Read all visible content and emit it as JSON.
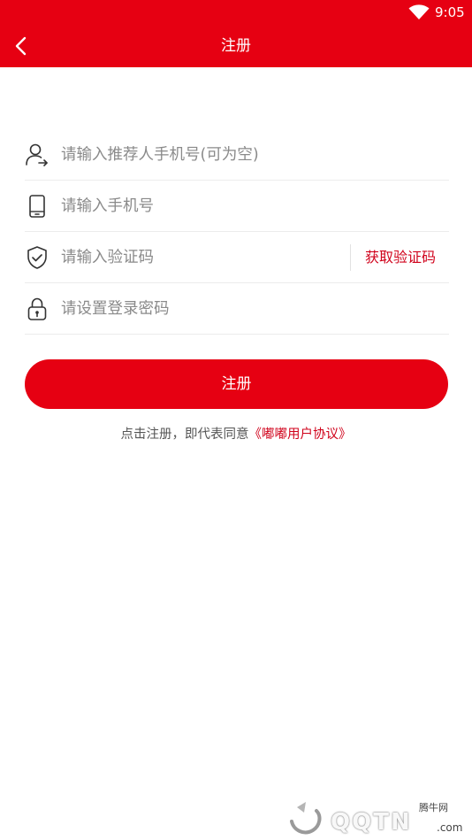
{
  "status_bar": {
    "time": "9:05",
    "wifi_icon": "wifi-icon"
  },
  "app_bar": {
    "back_icon": "chevron-left-icon",
    "title": "注册"
  },
  "form": {
    "referrer_placeholder": "请输入推荐人手机号(可为空)",
    "phone_placeholder": "请输入手机号",
    "code_placeholder": "请输入验证码",
    "get_code_label": "获取验证码",
    "password_placeholder": "请设置登录密码"
  },
  "register_button": {
    "label": "注册"
  },
  "agreement": {
    "prefix": "点击注册，即代表同意",
    "link": "《嘟嘟用户协议》"
  },
  "watermark": {
    "brand": "QQTN",
    "label": "腾牛网",
    "suffix": ".com"
  },
  "colors": {
    "brand_red": "#e60012",
    "link_red": "#d0021b"
  }
}
